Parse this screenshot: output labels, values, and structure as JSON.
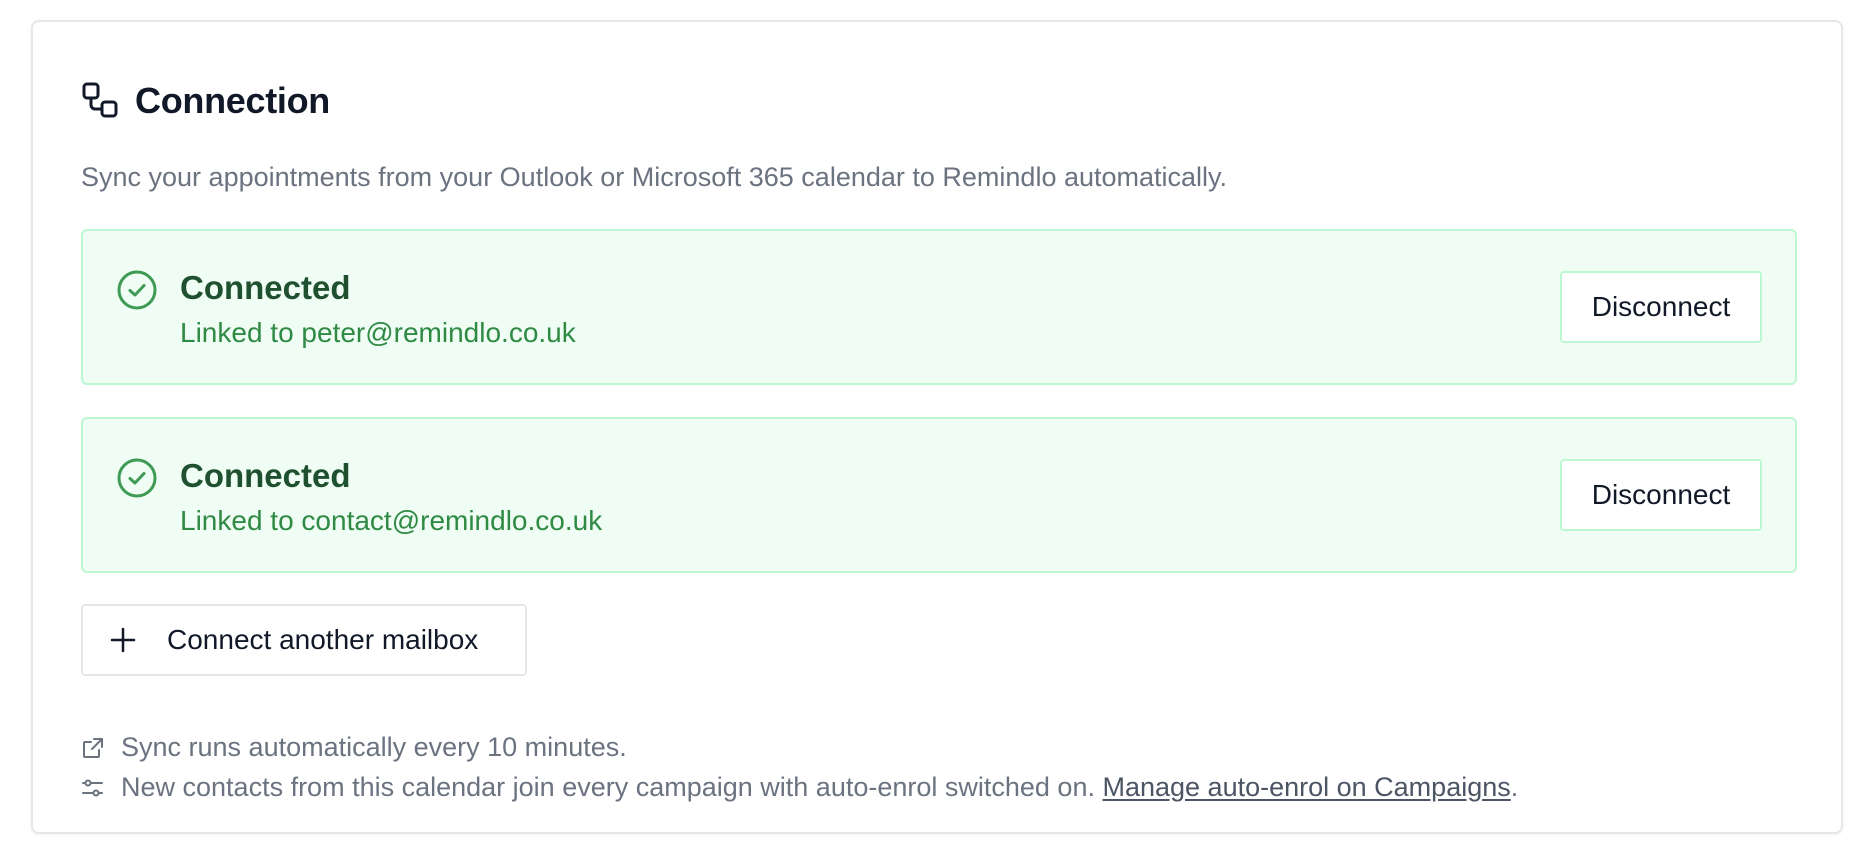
{
  "section": {
    "title": "Connection",
    "icon": "connection-icon",
    "subtitle": "Sync your appointments from your Outlook or Microsoft 365 calendar to Remindlo automatically."
  },
  "mailboxes": [
    {
      "status": "Connected",
      "linked_text": "Linked to peter@remindlo.co.uk",
      "action_label": "Disconnect"
    },
    {
      "status": "Connected",
      "linked_text": "Linked to contact@remindlo.co.uk",
      "action_label": "Disconnect"
    }
  ],
  "connect_button": {
    "label": "Connect another mailbox",
    "icon": "plus-icon"
  },
  "footnotes": {
    "sync": {
      "icon": "external-link-icon",
      "text": "Sync runs automatically every 10 minutes."
    },
    "auto_enrol": {
      "icon": "sliders-icon",
      "text": "New contacts from this calendar join every campaign with auto-enrol switched on.",
      "link_text": "Manage auto-enrol on Campaigns",
      "suffix": "."
    }
  },
  "colors": {
    "success_bg": "#f0fdf4",
    "success_border": "#bbf7d0",
    "success_text": "#2f8a44",
    "success_title": "#1f5130",
    "muted_text": "#6b7280"
  }
}
